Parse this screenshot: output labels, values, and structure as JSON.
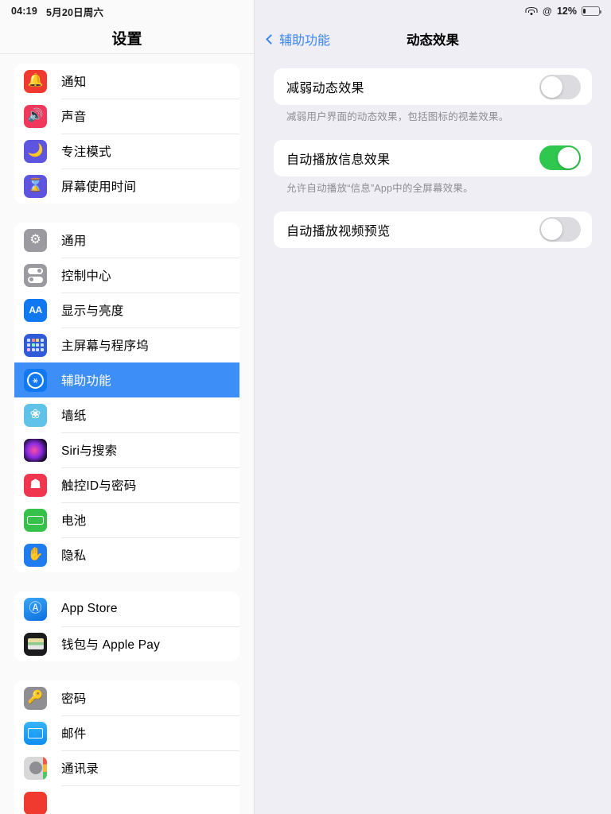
{
  "statusbar": {
    "time": "04:19",
    "date": "5月20日周六",
    "wifi_icon": "wifi-icon",
    "rotation_icon": "rotation-lock-icon",
    "battery_percent": "12%",
    "battery_level": 12,
    "battery_icon": "battery-low-icon"
  },
  "sidebar": {
    "title": "设置",
    "groups": [
      {
        "items": [
          {
            "label": "通知",
            "icon": "bell-icon",
            "icon_class": "ic-bell",
            "glyph": "🔔"
          },
          {
            "label": "声音",
            "icon": "speaker-icon",
            "icon_class": "ic-sound",
            "glyph": "🔊"
          },
          {
            "label": "专注模式",
            "icon": "moon-icon",
            "icon_class": "ic-focus",
            "glyph": "🌙"
          },
          {
            "label": "屏幕使用时间",
            "icon": "hourglass-icon",
            "icon_class": "ic-screen",
            "glyph": "⌛"
          }
        ]
      },
      {
        "items": [
          {
            "label": "通用",
            "icon": "gear-icon",
            "icon_class": "ic-gen",
            "glyph": "⚙"
          },
          {
            "label": "控制中心",
            "icon": "toggles-icon",
            "icon_class": "ic-cc",
            "glyph": ""
          },
          {
            "label": "显示与亮度",
            "icon": "text-size-icon",
            "icon_class": "ic-disp",
            "glyph": "AA"
          },
          {
            "label": "主屏幕与程序坞",
            "icon": "home-screen-grid-icon",
            "icon_class": "ic-home",
            "glyph": ""
          },
          {
            "label": "辅助功能",
            "icon": "accessibility-icon",
            "icon_class": "ic-acc",
            "glyph": "",
            "selected": true
          },
          {
            "label": "墙纸",
            "icon": "wallpaper-flower-icon",
            "icon_class": "ic-wall",
            "glyph": "❀"
          },
          {
            "label": "Siri与搜索",
            "icon": "siri-orb-icon",
            "icon_class": "ic-siri",
            "glyph": ""
          },
          {
            "label": "触控ID与密码",
            "icon": "fingerprint-icon",
            "icon_class": "ic-touch",
            "glyph": "☗"
          },
          {
            "label": "电池",
            "icon": "battery-icon",
            "icon_class": "ic-batt",
            "glyph": ""
          },
          {
            "label": "隐私",
            "icon": "hand-icon",
            "icon_class": "ic-priv",
            "glyph": "✋"
          }
        ]
      },
      {
        "items": [
          {
            "label": "App Store",
            "icon": "app-store-icon",
            "icon_class": "ic-apps",
            "glyph": "Ⓐ"
          },
          {
            "label": "钱包与 Apple Pay",
            "icon": "wallet-icon",
            "icon_class": "ic-wallet",
            "glyph": ""
          }
        ]
      },
      {
        "items": [
          {
            "label": "密码",
            "icon": "key-icon",
            "icon_class": "ic-pass",
            "glyph": "🔑"
          },
          {
            "label": "邮件",
            "icon": "mail-envelope-icon",
            "icon_class": "ic-mail",
            "glyph": ""
          },
          {
            "label": "通讯录",
            "icon": "contacts-icon",
            "icon_class": "ic-contact",
            "glyph": ""
          },
          {
            "label": "",
            "icon": "calendar-icon",
            "icon_class": "ic-cal",
            "glyph": ""
          }
        ]
      }
    ]
  },
  "detail": {
    "back_label": "辅助功能",
    "title": "动态效果",
    "rows": [
      {
        "label": "减弱动态效果",
        "toggle_state": "off",
        "footer": "减弱用户界面的动态效果，包括图标的视差效果。"
      },
      {
        "label": "自动播放信息效果",
        "toggle_state": "on",
        "footer": "允许自动播放“信息”App中的全屏幕效果。"
      },
      {
        "label": "自动播放视频预览",
        "toggle_state": "off",
        "footer": ""
      }
    ]
  },
  "annotation": {
    "arrow_icon": "red-arrow-pointing-down-right",
    "color": "#e8453c",
    "points_at": "减弱动态效果 toggle"
  },
  "colors": {
    "accent_blue": "#3d8ef7",
    "link_blue": "#3b87f0",
    "toggle_on_green": "#2fc74e",
    "toggle_off_gray": "#dcdce0",
    "detail_bg": "#eeeef4",
    "sidebar_bg": "#fafafa",
    "annotation_red": "#e8453c"
  }
}
